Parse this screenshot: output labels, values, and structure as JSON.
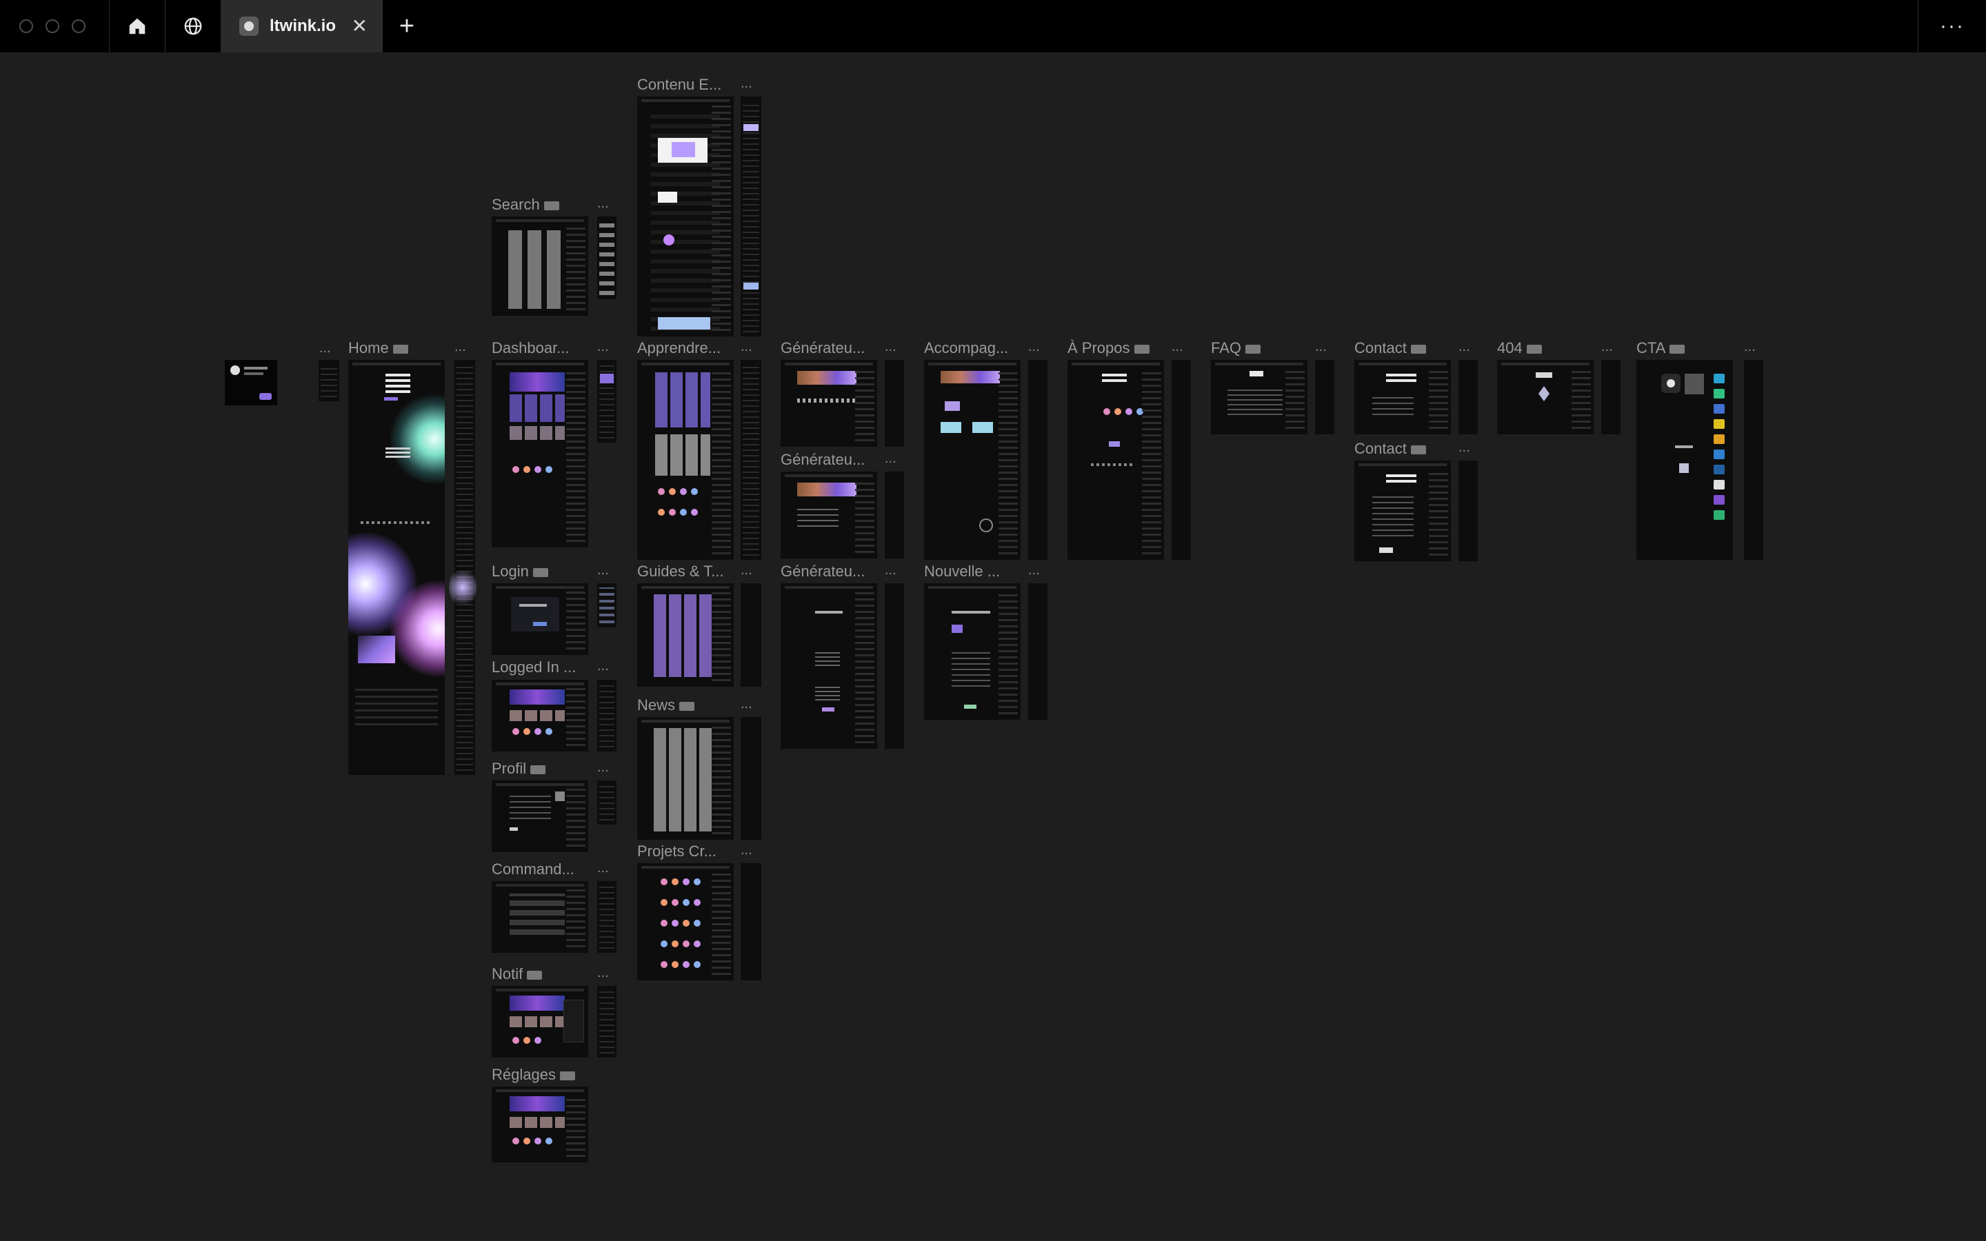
{
  "browser": {
    "tab_title": "ltwink.io",
    "tab_close_glyph": "✕",
    "new_tab_glyph": "+",
    "menu_glyph": "···",
    "icons": [
      "home-icon",
      "globe-icon",
      "site-favicon"
    ]
  },
  "canvas": {
    "more_glyph": "...",
    "frames": [
      {
        "label": "Contenu E..."
      },
      {
        "label": "Search"
      },
      {
        "label": "Home"
      },
      {
        "label": "Dashboar..."
      },
      {
        "label": "Apprendre..."
      },
      {
        "label": "Générateu..."
      },
      {
        "label": "Accompag..."
      },
      {
        "label": "À Propos"
      },
      {
        "label": "FAQ"
      },
      {
        "label": "Contact"
      },
      {
        "label": "404"
      },
      {
        "label": "CTA"
      },
      {
        "label": "Générateu..."
      },
      {
        "label": "Contact"
      },
      {
        "label": "Login"
      },
      {
        "label": "Guides & T..."
      },
      {
        "label": "Générateu..."
      },
      {
        "label": "Nouvelle ..."
      },
      {
        "label": "Logged In ..."
      },
      {
        "label": "News"
      },
      {
        "label": "Profil"
      },
      {
        "label": "Projets Cr..."
      },
      {
        "label": "Command..."
      },
      {
        "label": "Notif"
      },
      {
        "label": "Réglages"
      }
    ]
  },
  "colors": {
    "canvas_bg": "#1e1e1e",
    "topbar_bg": "#000000",
    "active_tab_bg": "#2b2b2b",
    "accent_purple": "#8a4fd6",
    "accent_teal": "#7ee0c8"
  }
}
